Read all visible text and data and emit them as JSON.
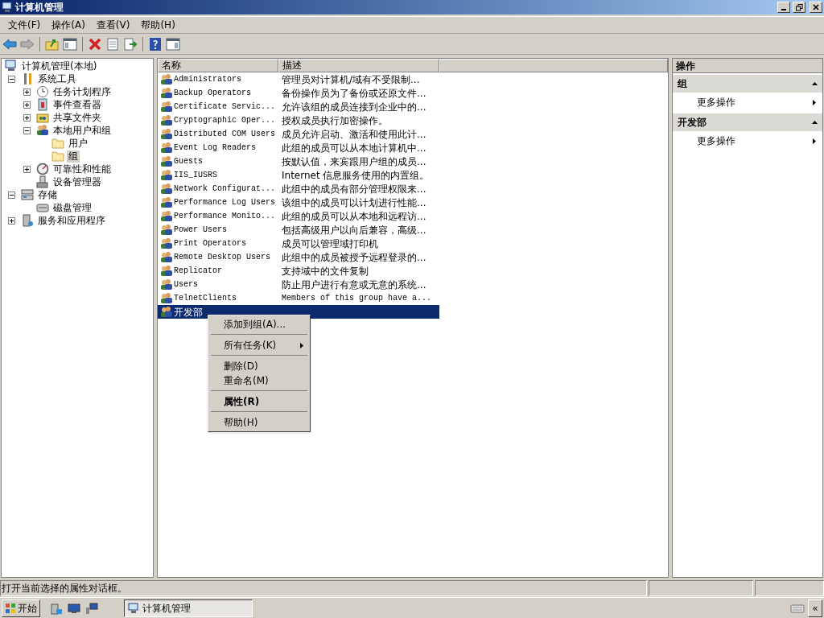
{
  "window": {
    "title": "计算机管理"
  },
  "menu": [
    {
      "label": "文件(F)"
    },
    {
      "label": "操作(A)"
    },
    {
      "label": "查看(V)"
    },
    {
      "label": "帮助(H)"
    }
  ],
  "tree": [
    {
      "label": "计算机管理(本地)",
      "kind": "computer",
      "selected": false,
      "children": [
        {
          "label": "系统工具",
          "kind": "tools",
          "selected": false,
          "expanded": true,
          "children": [
            {
              "label": "任务计划程序",
              "kind": "clock",
              "selected": false,
              "expanded": false
            },
            {
              "label": "事件查看器",
              "kind": "event",
              "selected": false,
              "expanded": false
            },
            {
              "label": "共享文件夹",
              "kind": "share",
              "selected": false,
              "expanded": false
            },
            {
              "label": "本地用户和组",
              "kind": "users",
              "selected": false,
              "expanded": true,
              "children": [
                {
                  "label": "用户",
                  "kind": "folder",
                  "selected": false
                },
                {
                  "label": "组",
                  "kind": "folder",
                  "selected": true
                }
              ]
            },
            {
              "label": "可靠性和性能",
              "kind": "gauge",
              "selected": false,
              "expanded": false
            },
            {
              "label": "设备管理器",
              "kind": "device",
              "selected": false
            }
          ]
        },
        {
          "label": "存储",
          "kind": "storage",
          "selected": false,
          "expanded": true,
          "children": [
            {
              "label": "磁盘管理",
              "kind": "disk",
              "selected": false
            }
          ]
        },
        {
          "label": "服务和应用程序",
          "kind": "services",
          "selected": false,
          "expanded": false
        }
      ]
    }
  ],
  "list": {
    "columns": [
      "名称",
      "描述"
    ],
    "rows": [
      {
        "name": "Administrators",
        "description": "管理员对计算机/域有不受限制...",
        "selected": false
      },
      {
        "name": "Backup Operators",
        "description": "备份操作员为了备份或还原文件...",
        "selected": false
      },
      {
        "name": "Certificate Servic...",
        "description": "允许该组的成员连接到企业中的...",
        "selected": false
      },
      {
        "name": "Cryptographic Oper...",
        "description": "授权成员执行加密操作。",
        "selected": false
      },
      {
        "name": "Distributed COM Users",
        "description": "成员允许启动、激活和使用此计...",
        "selected": false
      },
      {
        "name": "Event Log Readers",
        "description": "此组的成员可以从本地计算机中...",
        "selected": false
      },
      {
        "name": "Guests",
        "description": "按默认值，来宾跟用户组的成员...",
        "selected": false
      },
      {
        "name": "IIS_IUSRS",
        "description": "Internet 信息服务使用的内置组。",
        "selected": false
      },
      {
        "name": "Network Configurat...",
        "description": "此组中的成员有部分管理权限来...",
        "selected": false
      },
      {
        "name": "Performance Log Users",
        "description": "该组中的成员可以计划进行性能...",
        "selected": false
      },
      {
        "name": "Performance Monito...",
        "description": "此组的成员可以从本地和远程访...",
        "selected": false
      },
      {
        "name": "Power Users",
        "description": "包括高级用户以向后兼容，高级...",
        "selected": false
      },
      {
        "name": "Print Operators",
        "description": "成员可以管理域打印机",
        "selected": false
      },
      {
        "name": "Remote Desktop Users",
        "description": "此组中的成员被授予远程登录的...",
        "selected": false
      },
      {
        "name": "Replicator",
        "description": "支持域中的文件复制",
        "selected": false
      },
      {
        "name": "Users",
        "description": "防止用户进行有意或无意的系统...",
        "selected": false
      },
      {
        "name": "TelnetClients",
        "description": "Members of this group have a...",
        "selected": false
      },
      {
        "name": "开发部",
        "selected": true
      }
    ]
  },
  "context_menu": [
    {
      "kind": "item",
      "label": "添加到组(A)...",
      "default": false
    },
    {
      "kind": "separator"
    },
    {
      "kind": "submenu",
      "label": "所有任务(K)",
      "default": false
    },
    {
      "kind": "separator"
    },
    {
      "kind": "item",
      "label": "删除(D)",
      "default": false
    },
    {
      "kind": "item",
      "label": "重命名(M)",
      "default": false
    },
    {
      "kind": "separator"
    },
    {
      "kind": "item",
      "label": "属性(R)",
      "default": true
    },
    {
      "kind": "separator"
    },
    {
      "kind": "item",
      "label": "帮助(H)",
      "default": false
    }
  ],
  "actions": {
    "title": "操作",
    "sections": [
      {
        "title": "组",
        "expanded": true,
        "items": [
          {
            "label": "更多操作"
          }
        ]
      },
      {
        "title": "开发部",
        "expanded": true,
        "items": [
          {
            "label": "更多操作"
          }
        ]
      }
    ]
  },
  "status_bar": {
    "text": "打开当前选择的属性对话框。"
  },
  "taskbar": {
    "start": "开始",
    "tasks": [
      {
        "label": "计算机管理",
        "selected": true
      }
    ],
    "tray_button": "«"
  }
}
